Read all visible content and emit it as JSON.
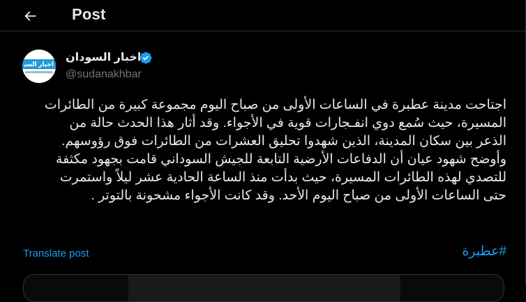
{
  "header": {
    "back_icon": "arrow-left-icon",
    "title": "Post"
  },
  "author": {
    "avatar_text": "اخبار السودان",
    "display_name": "اخبار السودان",
    "verified_icon": "verified-badge-icon",
    "handle": "@sudanakhbar"
  },
  "post": {
    "lines": [
      "اجتاحت مدينة عطبرة في الساعات الأولى من صباح اليوم مجموعة كبيرة من الطائرات",
      "المسيرة، حيث سُمع دوي انفـجارات قوية في الأجواء. وقد أثار هذا الحدث حالة من",
      "الذعر بين سكان المدينة، الذين شهدوا تحليق العشرات من الطائرات فوق رؤوسهم.",
      "وأوضح شهود عيان أن الدفاعات الأرضية التابعة للجيش السوداني قامت بجهود مكثفة",
      "للتصدي لهذه الطائرات المسيرة، حيث بدأت منذ الساعة الحادية عشر ليلاً واستمرت",
      "حتى الساعات الأولى من صباح اليوم الأحد. وقد كانت الأجواء مشحونة بالتوتر ."
    ],
    "hashtag": "#عطبرة",
    "translate_label": "Translate post"
  },
  "colors": {
    "background": "#000000",
    "text": "#e7e9ea",
    "muted": "#71767b",
    "accent": "#1d9bf0",
    "border": "#2f3336"
  }
}
